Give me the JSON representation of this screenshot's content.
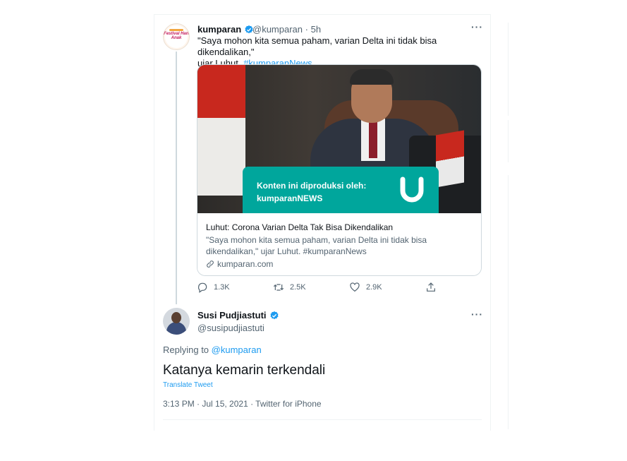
{
  "tweet1": {
    "display_name": "kumparan",
    "handle": "@kumparan",
    "separator": "·",
    "time": "5h",
    "more_label": "···",
    "text_line1": "\"Saya mohon kita semua paham, varian Delta ini tidak bisa dikendalikan,\"",
    "text_line2_prefix": "ujar Luhut.",
    "hashtag": "#kumparanNews",
    "avatar_text": "Festival Hari Anak",
    "card": {
      "banner_line1": "Konten ini diproduksi oleh:",
      "banner_line2": "kumparanNEWS",
      "title": "Luhut: Corona Varian Delta Tak Bisa Dikendalikan",
      "desc_line1": "\"Saya mohon kita semua paham, varian Delta ini tidak bisa",
      "desc_line2": "dikendalikan,\" ujar Luhut. #kumparanNews",
      "domain": "kumparan.com"
    },
    "actions": {
      "reply_count": "1.3K",
      "retweet_count": "2.5K",
      "like_count": "2.9K"
    }
  },
  "tweet2": {
    "display_name": "Susi Pudjiastuti",
    "handle": "@susipudjiastuti",
    "more_label": "···",
    "replying_prefix": "Replying to",
    "replying_mention": "@kumparan",
    "text": "Katanya kemarin terkendali",
    "translate_label": "Translate Tweet",
    "timestamp": "3:13 PM · Jul 15, 2021 · Twitter for iPhone"
  },
  "colors": {
    "accent": "#1d9bf0",
    "text_primary": "#0f1419",
    "text_secondary": "#536471",
    "banner": "#00a69c",
    "border": "#cfd9de"
  }
}
